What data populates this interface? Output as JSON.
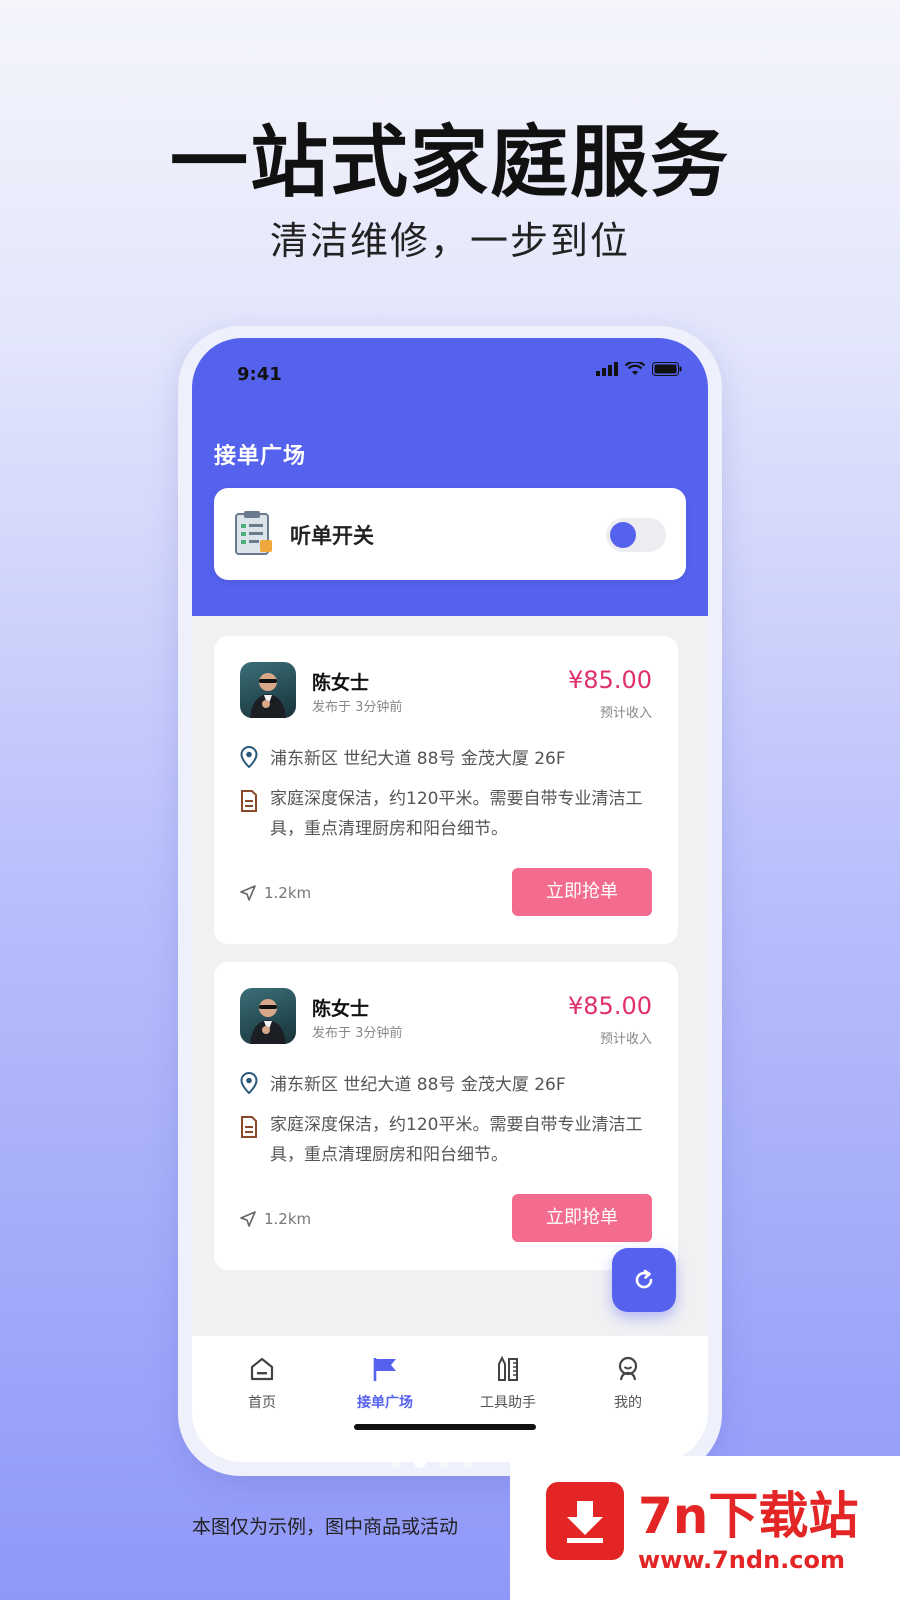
{
  "promo": {
    "headline": "一站式家庭服务",
    "subline": "清洁维修，一步到位",
    "disclaimer": "本图仅为示例，图中商品或活动"
  },
  "status_bar": {
    "time": "9:41"
  },
  "header": {
    "title": "接单广场",
    "switch_label": "听单开关",
    "switch_on": true
  },
  "orders": [
    {
      "name": "陈女士",
      "posted": "发布于 3分钟前",
      "price": "¥85.00",
      "price_label": "预计收入",
      "address": "浦东新区 世纪大道 88号 金茂大厦 26F",
      "description": "家庭深度保洁，约120平米。需要自带专业清洁工具，重点清理厨房和阳台细节。",
      "distance": "1.2km",
      "action": "立即抢单"
    },
    {
      "name": "陈女士",
      "posted": "发布于 3分钟前",
      "price": "¥85.00",
      "price_label": "预计收入",
      "address": "浦东新区 世纪大道 88号 金茂大厦 26F",
      "description": "家庭深度保洁，约120平米。需要自带专业清洁工具，重点清理厨房和阳台细节。",
      "distance": "1.2km",
      "action": "立即抢单"
    }
  ],
  "tabs": [
    {
      "label": "首页",
      "icon": "home-icon",
      "active": false
    },
    {
      "label": "接单广场",
      "icon": "flag-icon",
      "active": true
    },
    {
      "label": "工具助手",
      "icon": "tools-icon",
      "active": false
    },
    {
      "label": "我的",
      "icon": "profile-icon",
      "active": false
    }
  ],
  "watermark": {
    "title": "7n下载站",
    "url": "www.7ndn.com"
  },
  "colors": {
    "primary": "#5562ee",
    "price": "#e0306a",
    "grab_button": "#f36c8e",
    "watermark": "#e32525"
  }
}
